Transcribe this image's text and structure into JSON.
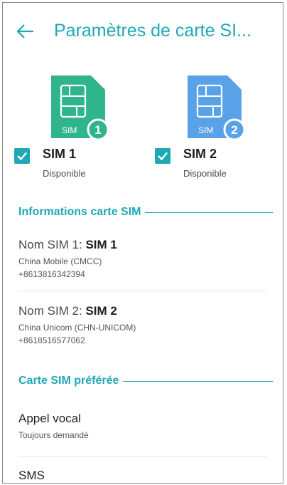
{
  "header": {
    "title": "Paramètres de carte SI..."
  },
  "sims": [
    {
      "badge": "1",
      "chip_label": "SIM",
      "name": "SIM 1",
      "status": "Disponible",
      "card_color": "#2fb48c",
      "checked": true
    },
    {
      "badge": "2",
      "chip_label": "SIM",
      "name": "SIM 2",
      "status": "Disponible",
      "card_color": "#5aa2e8",
      "checked": true
    }
  ],
  "info_section": {
    "title": "Informations carte SIM",
    "items": [
      {
        "label": "Nom SIM 1: ",
        "value": "SIM 1",
        "carrier": "China Mobile (CMCC)",
        "number": "+8613816342394"
      },
      {
        "label": "Nom SIM 2: ",
        "value": "SIM 2",
        "carrier": "China Unicom (CHN-UNICOM)",
        "number": "+8618516577062"
      }
    ]
  },
  "preferred_section": {
    "title": "Carte SIM préférée",
    "items": [
      {
        "title": "Appel vocal",
        "subtitle": "Toujours demandé"
      },
      {
        "title": "SMS"
      }
    ]
  },
  "colors": {
    "accent": "#20a8b5",
    "sim1": "#2fb48c",
    "sim2": "#5aa2e8"
  }
}
